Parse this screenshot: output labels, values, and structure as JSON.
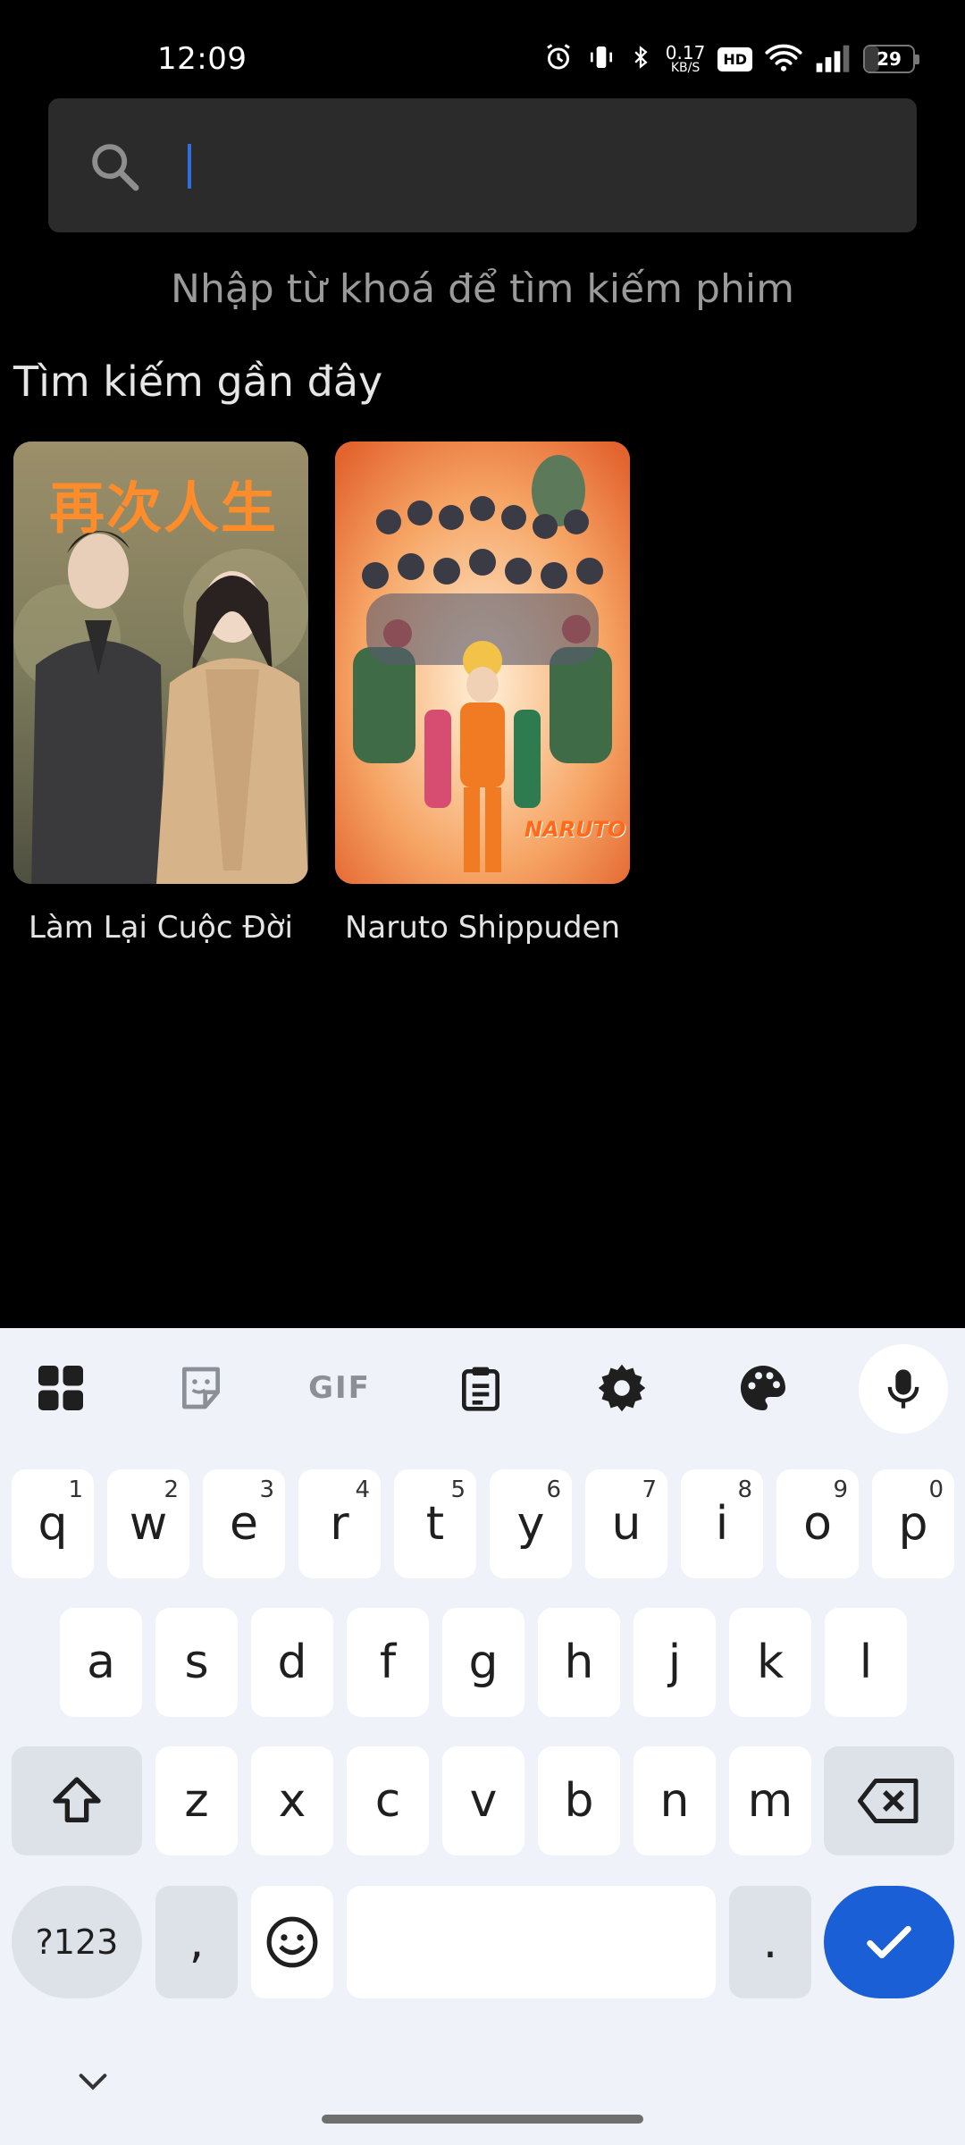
{
  "status_bar": {
    "time": "12:09",
    "net_speed_value": "0.17",
    "net_speed_unit": "KB/S",
    "hd_badge": "HD",
    "battery_level": "29",
    "icons": [
      "alarm-icon",
      "vibrate-icon",
      "bluetooth-icon",
      "wifi-icon",
      "signal-icon",
      "battery-icon"
    ]
  },
  "search": {
    "placeholder": "",
    "value": "",
    "icon": "search-icon",
    "caret_color": "#2f6fe0"
  },
  "hint_text": "Nhập từ khoá để tìm kiếm phim",
  "recent": {
    "title": "Tìm kiếm gần đây",
    "items": [
      {
        "title": "Làm Lại Cuộc Đời",
        "poster_text": "再次人生"
      },
      {
        "title": "Naruto Shippuden",
        "poster_text": "NARUTO"
      }
    ]
  },
  "keyboard": {
    "toolbar": [
      "apps-grid-icon",
      "sticker-icon",
      "gif-icon",
      "clipboard-icon",
      "settings-gear-icon",
      "palette-icon",
      "microphone-icon"
    ],
    "gif_label": "GIF",
    "row1": [
      {
        "key": "q",
        "hint": "1"
      },
      {
        "key": "w",
        "hint": "2"
      },
      {
        "key": "e",
        "hint": "3"
      },
      {
        "key": "r",
        "hint": "4"
      },
      {
        "key": "t",
        "hint": "5"
      },
      {
        "key": "y",
        "hint": "6"
      },
      {
        "key": "u",
        "hint": "7"
      },
      {
        "key": "i",
        "hint": "8"
      },
      {
        "key": "o",
        "hint": "9"
      },
      {
        "key": "p",
        "hint": "0"
      }
    ],
    "row2": [
      "a",
      "s",
      "d",
      "f",
      "g",
      "h",
      "j",
      "k",
      "l"
    ],
    "row3": [
      "z",
      "x",
      "c",
      "v",
      "b",
      "n",
      "m"
    ],
    "symbols_label": "?123",
    "comma": ",",
    "period": ".",
    "accent_color": "#1a5fd6"
  }
}
